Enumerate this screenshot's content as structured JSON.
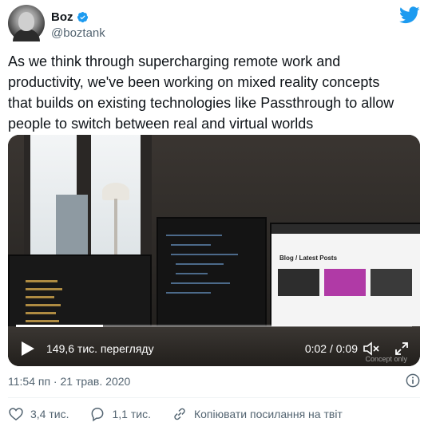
{
  "author": {
    "display_name": "Boz",
    "handle": "@boztank",
    "verified": true
  },
  "tweet": {
    "text": "As we think through supercharging remote work and\nproductivity, we've been working on mixed reality concepts\nthat builds on existing technologies like Passthrough to allow\npeople to switch between real and virtual worlds"
  },
  "video": {
    "views": "149,6 тис. перегляду",
    "time": "0:02 / 0:09",
    "progress": 0.22,
    "watermark": "Concept only",
    "screen_title": "Blog / Latest Posts"
  },
  "meta": {
    "timestamp": "11:54 пп · 21 трав. 2020"
  },
  "actions": {
    "likes": "3,4 тис.",
    "replies": "1,1 тис.",
    "copy_link": "Копіювати посилання на твіт"
  },
  "colors": {
    "twitter_blue": "#1d9bf0",
    "muted_text": "#536471",
    "text": "#0f1419"
  },
  "icons": [
    "twitter-logo-icon",
    "verified-icon",
    "play-icon",
    "volume-icon",
    "fullscreen-icon",
    "info-icon",
    "heart-icon",
    "reply-icon",
    "link-icon"
  ]
}
